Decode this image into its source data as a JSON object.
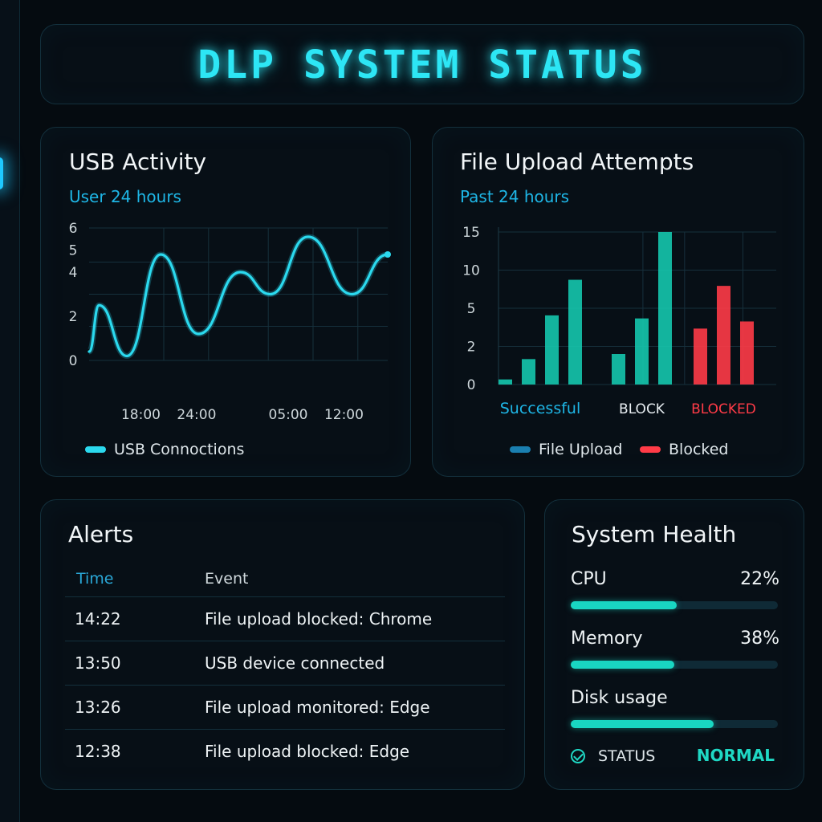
{
  "header": {
    "title": "DLP SYSTEM STATUS"
  },
  "usb_panel": {
    "title": "USB Activity",
    "subtitle": "User 24 hours",
    "legend": "USB Connoctions"
  },
  "upload_panel": {
    "title": "File Upload Attempts",
    "subtitle": "Past 24 hours",
    "legend": [
      {
        "label": "File Upload",
        "color": "#1a7fb0"
      },
      {
        "label": "Blocked",
        "color": "#ff3b47"
      }
    ]
  },
  "alerts": {
    "title": "Alerts",
    "columns": [
      "Time",
      "Event"
    ],
    "rows": [
      {
        "time": "14:22",
        "event": "File upload blocked: Chrome"
      },
      {
        "time": "13:50",
        "event": "USB device connected"
      },
      {
        "time": "13:26",
        "event": "File upload monitored: Edge"
      },
      {
        "time": "12:38",
        "event": "File upload blocked: Edge"
      }
    ]
  },
  "health": {
    "title": "System Health",
    "metrics": [
      {
        "label": "CPU",
        "value": "22%",
        "level": 0.51
      },
      {
        "label": "Memory",
        "value": "38%",
        "level": 0.5
      },
      {
        "label": "Disk usage",
        "value": "",
        "level": 0.69
      }
    ],
    "status_label": "STATUS",
    "status_value": "NORMAL"
  },
  "chart_data": [
    {
      "type": "line",
      "title": "USB Activity",
      "subtitle": "User 24 hours",
      "series": [
        {
          "name": "USB Connoctions",
          "color": "#2bd9ee",
          "points": [
            [
              0,
              0.4
            ],
            [
              0.25,
              2.5
            ],
            [
              0.95,
              0.2
            ],
            [
              1.8,
              4.8
            ],
            [
              2.75,
              1.2
            ],
            [
              3.8,
              4.0
            ],
            [
              4.55,
              3.0
            ],
            [
              5.5,
              5.6
            ],
            [
              6.6,
              3.0
            ],
            [
              7.5,
              4.8
            ]
          ]
        }
      ],
      "xlim": [
        0,
        7.5
      ],
      "x_ticks": [
        {
          "x": 1.3,
          "label": "18:00"
        },
        {
          "x": 2.7,
          "label": "24:00"
        },
        {
          "x": 5.0,
          "label": "05:00"
        },
        {
          "x": 6.4,
          "label": "12:00"
        }
      ],
      "ylim": [
        0,
        6
      ],
      "y_ticks": [
        {
          "value": 0,
          "label": "0"
        },
        {
          "value": 2,
          "label": "2"
        },
        {
          "value": 4,
          "label": "4"
        },
        {
          "value": 5,
          "label": "5"
        },
        {
          "value": 6,
          "label": "6"
        }
      ],
      "grid": true
    },
    {
      "type": "bar",
      "title": "File Upload Attempts",
      "subtitle": "Past 24 hours",
      "ylim": [
        0,
        15
      ],
      "y_ticks": [
        {
          "value": 0,
          "label": "0"
        },
        {
          "value": 3.75,
          "label": "2"
        },
        {
          "value": 7.5,
          "label": "5"
        },
        {
          "value": 11.25,
          "label": "10"
        },
        {
          "value": 15,
          "label": "15"
        }
      ],
      "groups": [
        {
          "label": "Successful",
          "label_color": "#1eb6e6",
          "color": "#15c7ad",
          "values": [
            0.5,
            2.5,
            6.8,
            10.3
          ]
        },
        {
          "label": "BLOCK",
          "label_color": "#e8eef2",
          "color": "#15c7ad",
          "values": [
            3.0,
            6.5,
            15.0
          ]
        },
        {
          "label": "BLOCKED",
          "label_color": "#ff3b47",
          "color": "#ff3b47",
          "values": [
            5.5,
            9.7,
            6.2
          ]
        }
      ],
      "grid": true
    }
  ]
}
